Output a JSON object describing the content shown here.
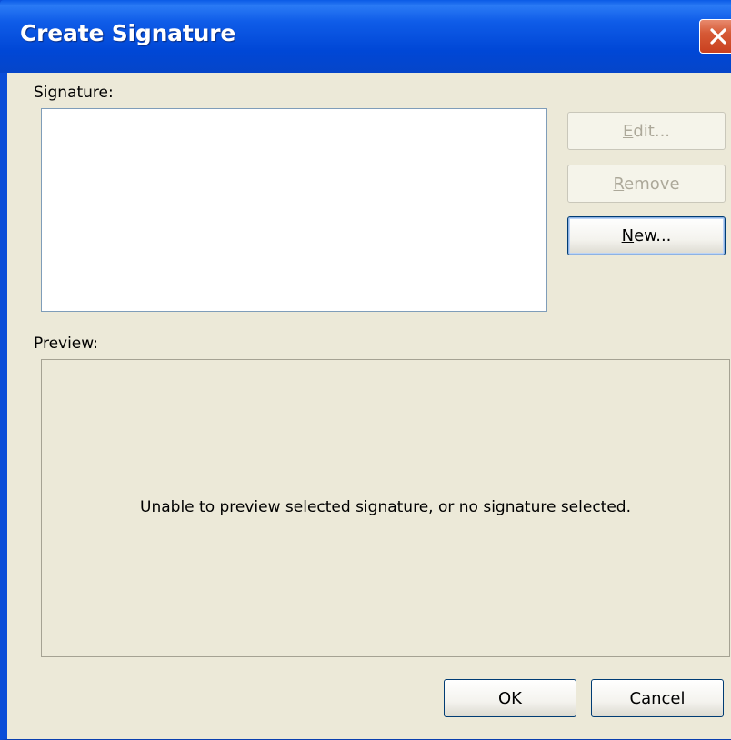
{
  "window": {
    "title": "Create Signature",
    "close_icon": "close-icon"
  },
  "signature": {
    "label": "Signature:",
    "items": []
  },
  "buttons": {
    "edit": {
      "prefix": "",
      "accel": "E",
      "suffix": "dit...",
      "enabled": false
    },
    "remove": {
      "prefix": "",
      "accel": "R",
      "suffix": "emove",
      "enabled": false
    },
    "new": {
      "prefix": "",
      "accel": "N",
      "suffix": "ew...",
      "enabled": true
    },
    "ok": "OK",
    "cancel": "Cancel"
  },
  "preview": {
    "label": "Preview:",
    "message": "Unable to preview selected signature, or no signature selected."
  },
  "colors": {
    "titlebar": "#0054e3",
    "dialog_bg": "#ece9d8",
    "close_button": "#d65a36",
    "disabled_text": "#aca899"
  }
}
